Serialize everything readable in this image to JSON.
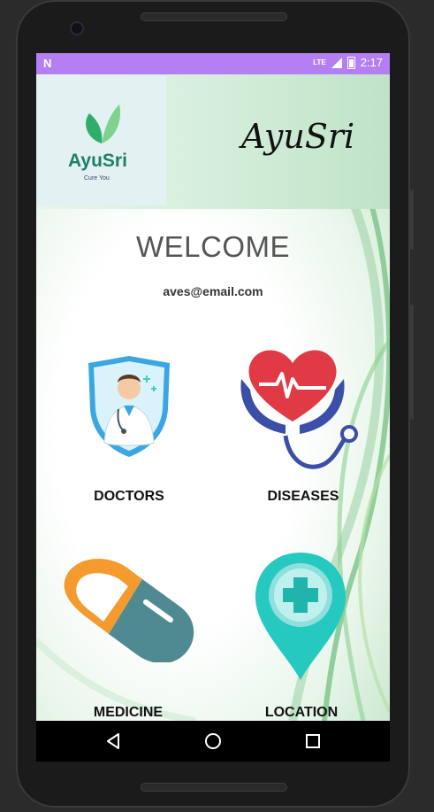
{
  "status_bar": {
    "network": "LTE",
    "time": "2:17"
  },
  "header": {
    "logo_name": "AyuSri",
    "logo_tagline": "Cure You",
    "brand_title": "AyuSri"
  },
  "welcome": {
    "title": "WELCOME",
    "email": "aves@email.com"
  },
  "tiles": [
    {
      "label": "DOCTORS",
      "icon": "doctor-shield-icon"
    },
    {
      "label": "DISEASES",
      "icon": "heart-stethoscope-icon"
    },
    {
      "label": "MEDICINE",
      "icon": "pill-capsule-icon"
    },
    {
      "label": "LOCATION",
      "icon": "location-pin-cross-icon"
    }
  ],
  "nav": {
    "back": "back-icon",
    "home": "home-icon",
    "recents": "recents-icon"
  },
  "colors": {
    "status_bar": "#b57ff4",
    "logo_green": "#1e7f66",
    "pill_orange": "#f59a2e",
    "pill_teal": "#4f8a93",
    "heart_red": "#e03a45",
    "hands_blue": "#3c4fa8",
    "pin_teal": "#26c9c0"
  }
}
